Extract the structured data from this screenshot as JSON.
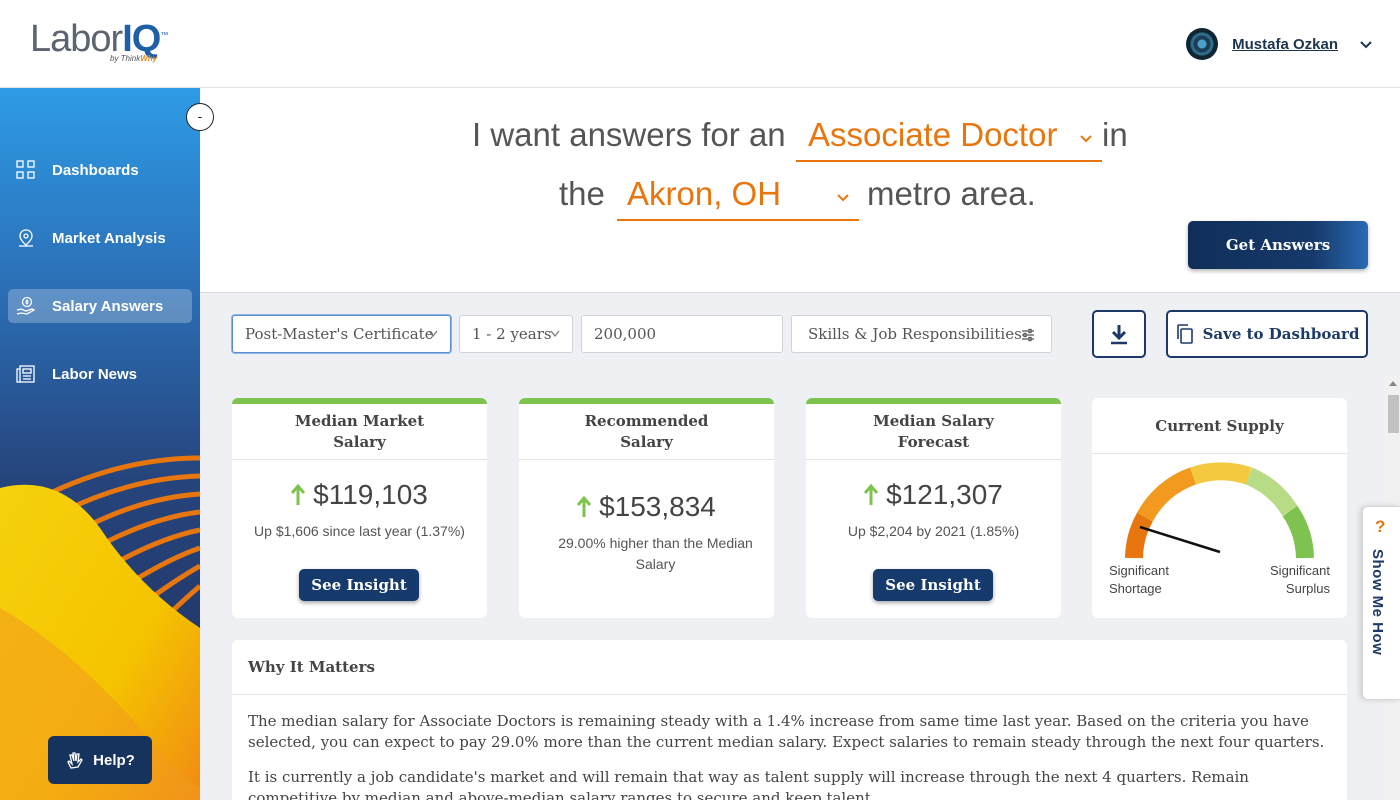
{
  "brand": {
    "logo_main": "Labor",
    "logo_accent": "IQ",
    "logo_tm": "™",
    "logo_by": "by Think",
    "logo_by_accent": "Why"
  },
  "user": {
    "name": "Mustafa Ozkan"
  },
  "sidebar": {
    "collapse_label": "-",
    "items": [
      {
        "label": "Dashboards",
        "icon": "grid-icon"
      },
      {
        "label": "Market Analysis",
        "icon": "map-pin-icon"
      },
      {
        "label": "Salary Answers",
        "icon": "money-hand-icon"
      },
      {
        "label": "Labor News",
        "icon": "newspaper-icon"
      }
    ],
    "active_index": 2,
    "help_label": "Help?"
  },
  "question": {
    "part1": "I want answers for an",
    "job": "Associate Doctor",
    "part2": "in",
    "part3": "the",
    "location": "Akron, OH",
    "part4": "metro area.",
    "button": "Get Answers"
  },
  "filters": {
    "education": "Post-Master's Certificate",
    "experience": "1 - 2 years",
    "salary": "200,000",
    "skills": "Skills & Job Responsibilities",
    "save_label": "Save to Dashboard"
  },
  "cards": [
    {
      "title_l1": "Median Market",
      "title_l2": "Salary",
      "value": "$119,103",
      "sub": "Up $1,606 since last year (1.37%)",
      "button": "See Insight"
    },
    {
      "title_l1": "Recommended",
      "title_l2": "Salary",
      "value": "$153,834",
      "sub": "29.00% higher than the Median Salary"
    },
    {
      "title_l1": "Median Salary",
      "title_l2": "Forecast",
      "value": "$121,307",
      "sub": "Up $2,204 by 2021 (1.85%)",
      "button": "See Insight"
    }
  ],
  "supply": {
    "title": "Current Supply",
    "left_l1": "Significant",
    "left_l2": "Shortage",
    "right_l1": "Significant",
    "right_l2": "Surplus",
    "colors": [
      "#e8760f",
      "#f29a1f",
      "#f5c842",
      "#b8dc86",
      "#7ec34f"
    ]
  },
  "why": {
    "title": "Why It Matters",
    "p1": "The median salary for Associate Doctors is remaining steady with a 1.4% increase from same time last year. Based on the criteria you have selected, you can expect to pay 29.0% more than the current median salary. Expect salaries to remain steady through the next four quarters.",
    "p2": "It is currently a job candidate's market and will remain that way as talent supply will increase through the next 4 quarters. Remain competitive by median and above-median salary ranges to secure and keep talent."
  },
  "show_me": {
    "q": "?",
    "label": "Show Me How"
  },
  "colors": {
    "accent": "#e8760f",
    "navy": "#163a6c",
    "green": "#7ec34f"
  }
}
